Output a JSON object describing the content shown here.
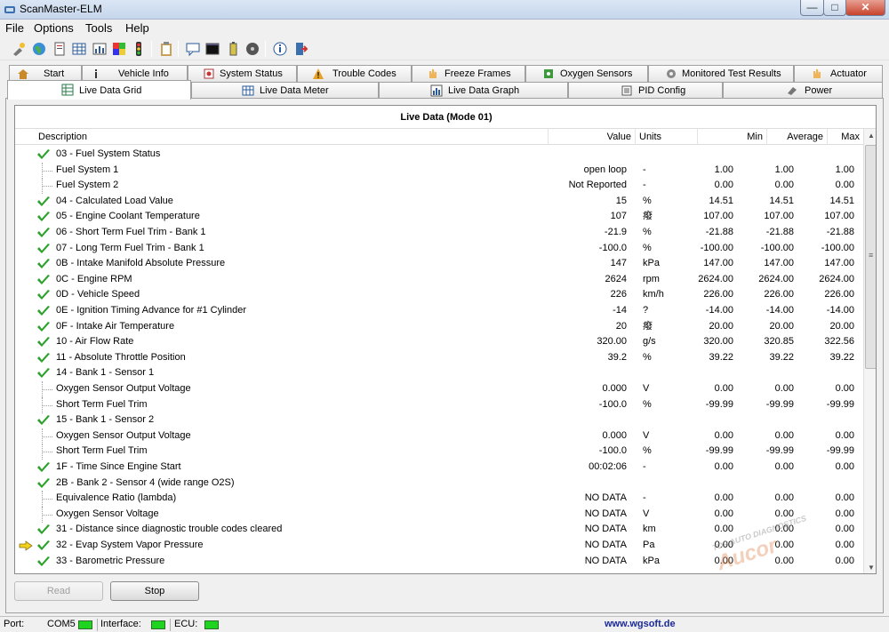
{
  "window": {
    "title": "ScanMaster-ELM"
  },
  "menu": [
    "File",
    "Options",
    "Tools",
    "Help"
  ],
  "toolbar_icons": [
    "connect-icon",
    "globe-icon",
    "document-icon",
    "table-icon",
    "chart-icon",
    "grid-color-icon",
    "traffic-light-icon",
    "clipboard-icon",
    "chat-icon",
    "terminal-icon",
    "battery-icon",
    "disc-icon",
    "info-icon",
    "exit-icon"
  ],
  "tabs_row1": [
    {
      "label": "Start",
      "icon": "house-icon"
    },
    {
      "label": "Vehicle Info",
      "icon": "info-icon"
    },
    {
      "label": "System Status",
      "icon": "status-icon"
    },
    {
      "label": "Trouble Codes",
      "icon": "warning-icon"
    },
    {
      "label": "Freeze Frames",
      "icon": "hand-icon"
    },
    {
      "label": "Oxygen Sensors",
      "icon": "sensor-icon"
    },
    {
      "label": "Monitored Test Results",
      "icon": "gear-icon"
    },
    {
      "label": "Actuator",
      "icon": "hand-icon"
    }
  ],
  "tabs_row2": [
    {
      "label": "Live Data Grid",
      "icon": "grid-icon",
      "active": true
    },
    {
      "label": "Live Data Meter",
      "icon": "meter-icon"
    },
    {
      "label": "Live Data Graph",
      "icon": "graph-icon"
    },
    {
      "label": "PID Config",
      "icon": "config-icon"
    },
    {
      "label": "Power",
      "icon": "power-icon"
    }
  ],
  "grid": {
    "title": "Live Data (Mode 01)",
    "columns": {
      "description": "Description",
      "value": "Value",
      "units": "Units",
      "min": "Min",
      "average": "Average",
      "max": "Max"
    },
    "rows": [
      {
        "type": "main",
        "desc": "03 - Fuel System Status",
        "value": "",
        "units": "",
        "min": "",
        "avg": "",
        "max": ""
      },
      {
        "type": "sub",
        "desc": "Fuel System 1",
        "value": "open loop",
        "units": "-",
        "min": "1.00",
        "avg": "1.00",
        "max": "1.00"
      },
      {
        "type": "sub",
        "desc": "Fuel System 2",
        "value": "Not Reported",
        "units": "-",
        "min": "0.00",
        "avg": "0.00",
        "max": "0.00"
      },
      {
        "type": "main",
        "desc": "04 - Calculated Load Value",
        "value": "15",
        "units": "%",
        "min": "14.51",
        "avg": "14.51",
        "max": "14.51"
      },
      {
        "type": "main",
        "desc": "05 - Engine Coolant Temperature",
        "value": "107",
        "units": "癈",
        "min": "107.00",
        "avg": "107.00",
        "max": "107.00"
      },
      {
        "type": "main",
        "desc": "06 - Short Term Fuel Trim - Bank 1",
        "value": "-21.9",
        "units": "%",
        "min": "-21.88",
        "avg": "-21.88",
        "max": "-21.88"
      },
      {
        "type": "main",
        "desc": "07 - Long Term Fuel Trim - Bank 1",
        "value": "-100.0",
        "units": "%",
        "min": "-100.00",
        "avg": "-100.00",
        "max": "-100.00"
      },
      {
        "type": "main",
        "desc": "0B - Intake Manifold Absolute Pressure",
        "value": "147",
        "units": "kPa",
        "min": "147.00",
        "avg": "147.00",
        "max": "147.00"
      },
      {
        "type": "main",
        "desc": "0C - Engine RPM",
        "value": "2624",
        "units": "rpm",
        "min": "2624.00",
        "avg": "2624.00",
        "max": "2624.00"
      },
      {
        "type": "main",
        "desc": "0D - Vehicle Speed",
        "value": "226",
        "units": "km/h",
        "min": "226.00",
        "avg": "226.00",
        "max": "226.00"
      },
      {
        "type": "main",
        "desc": "0E - Ignition Timing Advance for #1 Cylinder",
        "value": "-14",
        "units": "?",
        "min": "-14.00",
        "avg": "-14.00",
        "max": "-14.00"
      },
      {
        "type": "main",
        "desc": "0F - Intake Air Temperature",
        "value": "20",
        "units": "癈",
        "min": "20.00",
        "avg": "20.00",
        "max": "20.00"
      },
      {
        "type": "main",
        "desc": "10 - Air Flow Rate",
        "value": "320.00",
        "units": "g/s",
        "min": "320.00",
        "avg": "320.85",
        "max": "322.56"
      },
      {
        "type": "main",
        "desc": "11 - Absolute Throttle Position",
        "value": "39.2",
        "units": "%",
        "min": "39.22",
        "avg": "39.22",
        "max": "39.22"
      },
      {
        "type": "main",
        "desc": "14 - Bank 1 - Sensor 1",
        "value": "",
        "units": "",
        "min": "",
        "avg": "",
        "max": ""
      },
      {
        "type": "sub",
        "desc": "Oxygen Sensor Output Voltage",
        "value": "0.000",
        "units": "V",
        "min": "0.00",
        "avg": "0.00",
        "max": "0.00"
      },
      {
        "type": "sub",
        "desc": "Short Term Fuel Trim",
        "value": "-100.0",
        "units": "%",
        "min": "-99.99",
        "avg": "-99.99",
        "max": "-99.99"
      },
      {
        "type": "main",
        "desc": "15 - Bank 1 - Sensor 2",
        "value": "",
        "units": "",
        "min": "",
        "avg": "",
        "max": ""
      },
      {
        "type": "sub",
        "desc": "Oxygen Sensor Output Voltage",
        "value": "0.000",
        "units": "V",
        "min": "0.00",
        "avg": "0.00",
        "max": "0.00"
      },
      {
        "type": "sub",
        "desc": "Short Term Fuel Trim",
        "value": "-100.0",
        "units": "%",
        "min": "-99.99",
        "avg": "-99.99",
        "max": "-99.99"
      },
      {
        "type": "main",
        "desc": "1F - Time Since Engine Start",
        "value": "00:02:06",
        "units": "-",
        "min": "0.00",
        "avg": "0.00",
        "max": "0.00"
      },
      {
        "type": "main",
        "desc": "2B - Bank 2 - Sensor 4 (wide range O2S)",
        "value": "",
        "units": "",
        "min": "",
        "avg": "",
        "max": ""
      },
      {
        "type": "sub",
        "desc": "Equivalence Ratio (lambda)",
        "value": "NO DATA",
        "units": "-",
        "min": "0.00",
        "avg": "0.00",
        "max": "0.00"
      },
      {
        "type": "sub",
        "desc": "Oxygen Sensor Voltage",
        "value": "NO DATA",
        "units": "V",
        "min": "0.00",
        "avg": "0.00",
        "max": "0.00"
      },
      {
        "type": "main",
        "desc": "31 - Distance since diagnostic trouble codes cleared",
        "value": "NO DATA",
        "units": "km",
        "min": "0.00",
        "avg": "0.00",
        "max": "0.00"
      },
      {
        "type": "main",
        "desc": "32 - Evap System Vapor Pressure",
        "value": "NO DATA",
        "units": "Pa",
        "min": "0.00",
        "avg": "0.00",
        "max": "0.00",
        "selected": true
      },
      {
        "type": "main",
        "desc": "33 - Barometric Pressure",
        "value": "NO DATA",
        "units": "kPa",
        "min": "0.00",
        "avg": "0.00",
        "max": "0.00"
      }
    ]
  },
  "buttons": {
    "read": "Read",
    "stop": "Stop"
  },
  "watermark": {
    "brand": "Aucor",
    "tagline": "TOP AUTO DIAGNOSTICS"
  },
  "statusbar": {
    "port_label": "Port:",
    "port_value": "COM5",
    "interface_label": "Interface:",
    "ecu_label": "ECU:",
    "website": "www.wgsoft.de"
  },
  "colors": {
    "led": "#1fd41f",
    "check": "#2aa12a",
    "arrow": "#f2d21b",
    "link": "#1a2a99"
  }
}
